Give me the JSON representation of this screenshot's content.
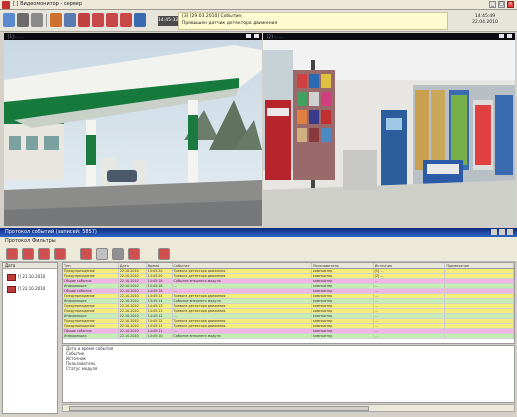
{
  "app": {
    "title": "[ ] Видеомонитор - сервер"
  },
  "toolbar": {
    "time_small": "14:45:32",
    "alarm_line1": "[3] [29.03.2010] Событие:",
    "alarm_line2": "Превышен датчик детектора движения",
    "clock_time": "14:45:49",
    "clock_date": "22.04.2010"
  },
  "cameras": [
    {
      "label": "[1] ... ...",
      "scene": "gas-station"
    },
    {
      "label": "[2] ... ...",
      "scene": "shop-interior"
    }
  ],
  "events": {
    "window_title": "Протокол событий (записей: 5857)",
    "menu": [
      "Протокол",
      "Фильтры"
    ],
    "date_tree_header": "Дата",
    "dates": [
      "[] 21.10.2010",
      "[] 22.10.2010"
    ],
    "columns": [
      "Тип",
      "Дата",
      "Время",
      "Событие",
      "Пользователь",
      "Источник",
      "Примечание"
    ],
    "rows": [
      {
        "type": "Предупреждение",
        "date": "22.10.2010",
        "time": "14:45:20",
        "event": "Тревога детектора движения",
        "user": "компьютер",
        "source": "[1] ..."
      },
      {
        "type": "Предупреждение",
        "date": "22.10.2010",
        "time": "14:45:20",
        "event": "Тревога детектора движения",
        "user": "компьютер",
        "source": "[2] ..."
      },
      {
        "type": "Общие события",
        "date": "22.10.2010",
        "time": "14:45:18",
        "event": "Событие внешнего модуля",
        "user": "компьютер",
        "source": "..."
      },
      {
        "type": "Информация",
        "date": "22.10.2010",
        "time": "14:45:18",
        "event": "...",
        "user": "компьютер",
        "source": "..."
      },
      {
        "type": "Общие события",
        "date": "22.10.2010",
        "time": "14:45:18",
        "event": "...",
        "user": "компьютер",
        "source": "..."
      },
      {
        "type": "Предупреждение",
        "date": "22.10.2010",
        "time": "14:45:14",
        "event": "Тревога детектора движения",
        "user": "компьютер",
        "source": "..."
      },
      {
        "type": "Информация",
        "date": "22.10.2010",
        "time": "14:45:14",
        "event": "Событие внешнего модуля",
        "user": "компьютер",
        "source": "..."
      },
      {
        "type": "Предупреждение",
        "date": "22.10.2010",
        "time": "14:45:13",
        "event": "Тревога детектора движения",
        "user": "компьютер",
        "source": "..."
      },
      {
        "type": "Предупреждение",
        "date": "22.10.2010",
        "time": "14:45:13",
        "event": "Тревога детектора движения",
        "user": "компьютер",
        "source": "..."
      },
      {
        "type": "Информация",
        "date": "22.10.2010",
        "time": "14:45:12",
        "event": "...",
        "user": "компьютер",
        "source": "..."
      },
      {
        "type": "Предупреждение",
        "date": "22.10.2010",
        "time": "14:45:12",
        "event": "Тревога детектора движения",
        "user": "компьютер",
        "source": "..."
      },
      {
        "type": "Предупреждение",
        "date": "22.10.2010",
        "time": "14:45:11",
        "event": "Тревога детектора движения",
        "user": "компьютер",
        "source": "..."
      },
      {
        "type": "Общие события",
        "date": "22.10.2010",
        "time": "14:45:11",
        "event": "...",
        "user": "компьютер",
        "source": "..."
      },
      {
        "type": "Информация",
        "date": "22.10.2010",
        "time": "14:45:10",
        "event": "Событие внешнего модуля",
        "user": "компьютер",
        "source": "..."
      }
    ],
    "details": [
      "Дата и время события",
      "Событие",
      "Источник",
      "Пользователь",
      "Статус модуля"
    ]
  },
  "colors": {
    "yellow": "#f6ee7c",
    "pink": "#f2b6e6",
    "green": "#c6edb4"
  }
}
